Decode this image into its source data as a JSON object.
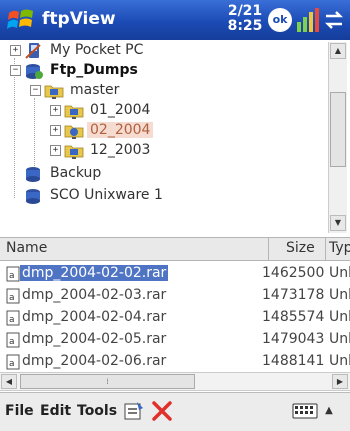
{
  "titlebar": {
    "app_title": "ftpView",
    "date": "2/21",
    "time": "8:25",
    "ok_label": "ok"
  },
  "tree": {
    "items": [
      {
        "label": "My Pocket PC",
        "expander": "+",
        "icon": "pocket-pc-icon"
      },
      {
        "label": "Ftp_Dumps",
        "expander": "−",
        "icon": "ftp-server-icon"
      },
      {
        "label": "master",
        "expander": "−",
        "icon": "network-folder-icon"
      },
      {
        "label": "01_2004",
        "expander": "+",
        "icon": "network-folder-icon"
      },
      {
        "label": "02_2004",
        "expander": "+",
        "icon": "network-folder-icon"
      },
      {
        "label": "12_2003",
        "expander": "+",
        "icon": "network-folder-icon"
      },
      {
        "label": "Backup",
        "icon": "ftp-server-icon"
      },
      {
        "label": "SCO Unixware 1",
        "icon": "ftp-server-icon"
      }
    ]
  },
  "list": {
    "columns": [
      "Name",
      "Size",
      "Typ"
    ],
    "rows": [
      {
        "name": "dmp_2004-02-02.rar",
        "size": "1462500",
        "type": "Unk"
      },
      {
        "name": "dmp_2004-02-03.rar",
        "size": "1473178",
        "type": "Unk"
      },
      {
        "name": "dmp_2004-02-04.rar",
        "size": "1485574",
        "type": "Unk"
      },
      {
        "name": "dmp_2004-02-05.rar",
        "size": "1479043",
        "type": "Unk"
      },
      {
        "name": "dmp_2004-02-06.rar",
        "size": "1488141",
        "type": "Unk"
      }
    ]
  },
  "menu": {
    "file": "File",
    "edit": "Edit",
    "tools": "Tools"
  },
  "colors": {
    "titlebar": "#1c4bb5",
    "selection": "#4f74c4",
    "tree_selection": "#f6dcd0",
    "delete_icon": "#e0302a"
  }
}
